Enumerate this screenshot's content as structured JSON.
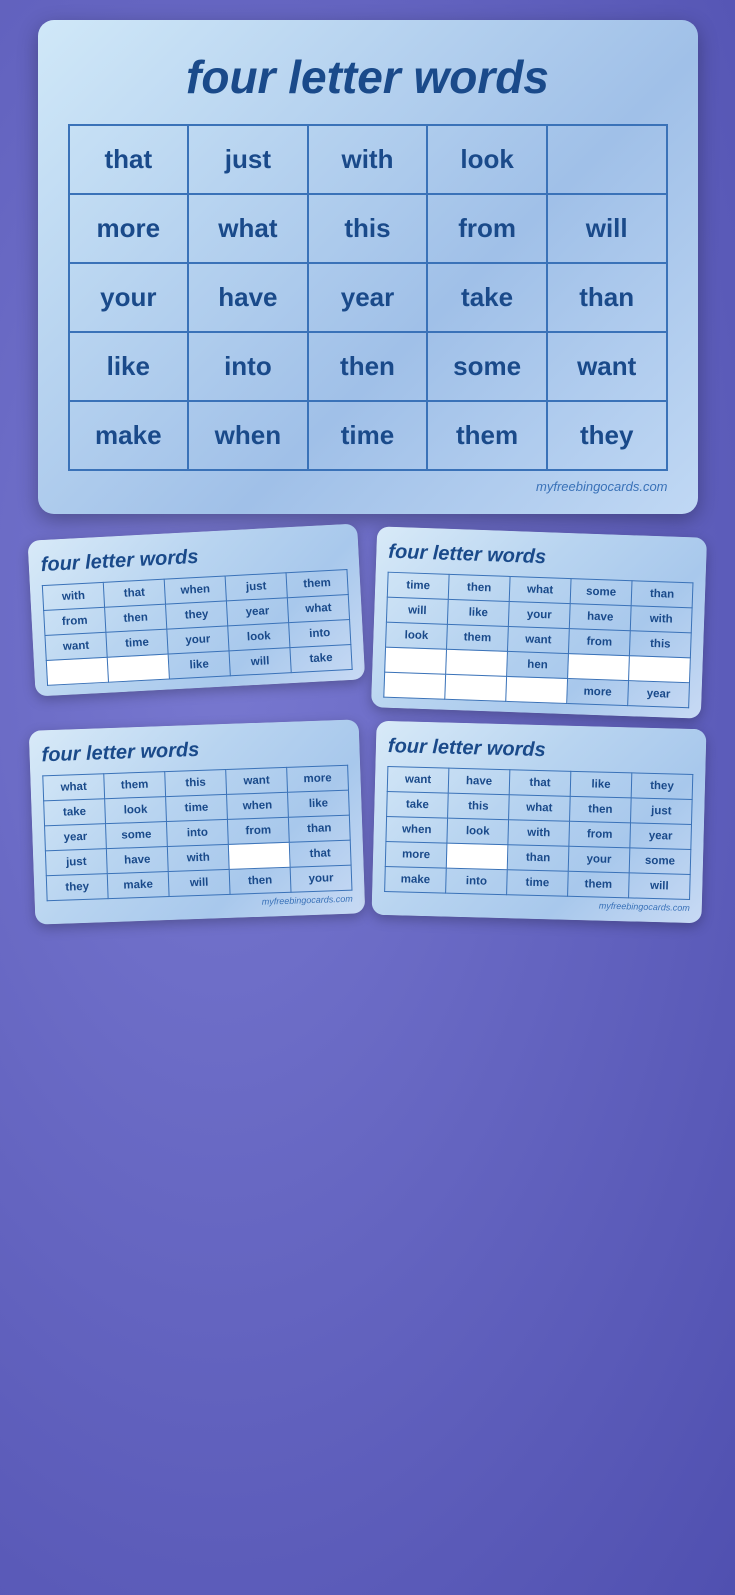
{
  "mainCard": {
    "title": "four letter words",
    "website": "myfreebingocards.com",
    "grid": [
      [
        "that",
        "just",
        "with",
        "look",
        ""
      ],
      [
        "more",
        "what",
        "this",
        "from",
        "will"
      ],
      [
        "your",
        "have",
        "year",
        "take",
        "than"
      ],
      [
        "like",
        "into",
        "then",
        "some",
        "want"
      ],
      [
        "make",
        "when",
        "time",
        "them",
        "they"
      ]
    ]
  },
  "card1": {
    "title": "four letter words",
    "grid": [
      [
        "with",
        "that",
        "when",
        "just",
        "them"
      ],
      [
        "from",
        "then",
        "they",
        "year",
        "what"
      ],
      [
        "want",
        "time",
        "your",
        "look",
        "into"
      ],
      [
        "",
        "",
        "like",
        "will",
        "take"
      ]
    ]
  },
  "card2": {
    "title": "four letter words",
    "website": "",
    "grid": [
      [
        "time",
        "then",
        "what",
        "some",
        "than"
      ],
      [
        "will",
        "like",
        "your",
        "have",
        "with"
      ],
      [
        "look",
        "them",
        "want",
        "from",
        "this"
      ],
      [
        "",
        "",
        "hen",
        "",
        ""
      ],
      [
        "",
        "",
        "",
        "more",
        "year"
      ]
    ]
  },
  "card3": {
    "title": "four letter words",
    "website": "myfreebingocards.com",
    "grid": [
      [
        "what",
        "them",
        "this",
        "want",
        "more"
      ],
      [
        "take",
        "look",
        "time",
        "when",
        "like"
      ],
      [
        "year",
        "some",
        "into",
        "from",
        "than"
      ],
      [
        "just",
        "have",
        "with",
        "",
        "that"
      ],
      [
        "they",
        "make",
        "will",
        "then",
        "your"
      ]
    ]
  },
  "card4": {
    "title": "four letter words",
    "website": "myfreebingocards.com",
    "grid": [
      [
        "want",
        "have",
        "that",
        "like",
        "they"
      ],
      [
        "take",
        "this",
        "what",
        "then",
        "just"
      ],
      [
        "when",
        "look",
        "with",
        "from",
        "year"
      ],
      [
        "more",
        "",
        "than",
        "your",
        "some"
      ],
      [
        "make",
        "into",
        "time",
        "them",
        "will"
      ]
    ]
  }
}
